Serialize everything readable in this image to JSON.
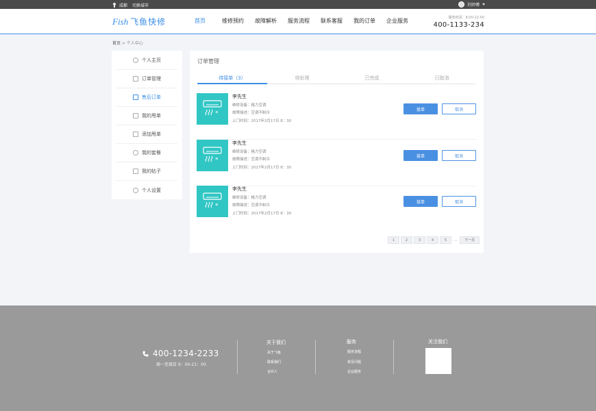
{
  "topbar": {
    "city": "成都",
    "switch_city": "切换城市",
    "user": "刘师傅"
  },
  "header": {
    "logo_en": "Fish",
    "logo_cn": "飞鱼快修",
    "nav": [
      "首页",
      "维修预约",
      "故障解析",
      "服务流程",
      "联系客服",
      "我的订单",
      "企业服务"
    ],
    "service_time": "服务时间：8:00-22:00",
    "phone": "400-1133-234"
  },
  "breadcrumb": {
    "home": "首页",
    "sep": " > ",
    "current": "个人中心"
  },
  "sidebar": {
    "items": [
      "个人主页",
      "订单管理",
      "售后订单",
      "我的甩单",
      "添加甩单",
      "我的套餐",
      "我的帖子",
      "个人设置"
    ]
  },
  "panel": {
    "title": "订单管理",
    "tabs": [
      "待接单（3）",
      "待处理",
      "已完成",
      "已取消"
    ]
  },
  "orders": [
    {
      "name": "李先生",
      "device": "维修设备：格力空调",
      "fault": "故障描述：空调不制冷",
      "time": "上门时间：2017年2月17日 8：30",
      "accept": "接单",
      "cancel": "取消"
    },
    {
      "name": "李先生",
      "device": "维修设备：格力空调",
      "fault": "故障描述：空调不制冷",
      "time": "上门时间：2017年2月17日 8：30",
      "accept": "接单",
      "cancel": "取消"
    },
    {
      "name": "李先生",
      "device": "维修设备：格力空调",
      "fault": "故障描述：空调不制冷",
      "time": "上门时间：2017年2月17日 8：30",
      "accept": "接单",
      "cancel": "取消"
    }
  ],
  "pagination": {
    "pages": [
      "1",
      "2",
      "3",
      "4",
      "5"
    ],
    "ellipsis": "…",
    "next": "下一页"
  },
  "footer": {
    "phone": "400-1234-2233",
    "hours": "周一至周日 9：00-21：00",
    "about_title": "关于我们",
    "about_links": [
      "关于飞鱼",
      "联系我们",
      "合伙人"
    ],
    "service_title": "服务",
    "service_links": [
      "服务流程",
      "常见问题",
      "企业服务"
    ],
    "follow_title": "关注我们"
  },
  "colors": {
    "accent": "#3a8ee6",
    "button": "#4a90e2",
    "thumb": "#30c6c4",
    "footer": "#9a9a9a",
    "topbar": "#4a4a4a"
  }
}
